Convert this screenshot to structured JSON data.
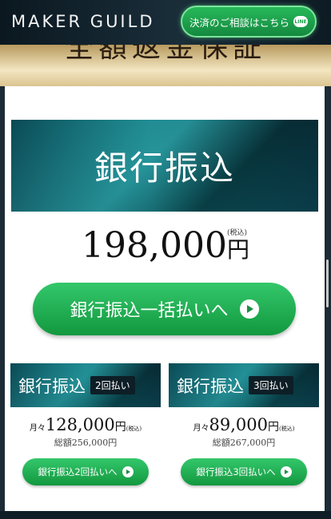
{
  "header": {
    "brand": "MAKER GUILD",
    "cta_label": "決済のご相談はこちら",
    "cta_icon_text": "LINE"
  },
  "hero": {
    "gold_text": "全額返金保証"
  },
  "main_plan": {
    "banner_title": "銀行振込",
    "price": "198,000",
    "yen": "円",
    "tax_note": "(税込)",
    "button_label": "銀行振込一括払いへ"
  },
  "plans": [
    {
      "title": "銀行振込",
      "badge": "2回払い",
      "monthly_prefix": "月々",
      "monthly_price": "128,000",
      "yen": "円",
      "tax_note": "(税込)",
      "total": "総額256,000円",
      "button_label": "銀行振込2回払いへ"
    },
    {
      "title": "銀行振込",
      "badge": "3回払い",
      "monthly_prefix": "月々",
      "monthly_price": "89,000",
      "yen": "円",
      "tax_note": "(税込)",
      "total": "総額267,000円",
      "button_label": "銀行振込3回払いへ"
    }
  ],
  "colors": {
    "accent_green": "#13983f",
    "banner_teal": "#0f6f78",
    "header_dark": "#0b1820"
  }
}
